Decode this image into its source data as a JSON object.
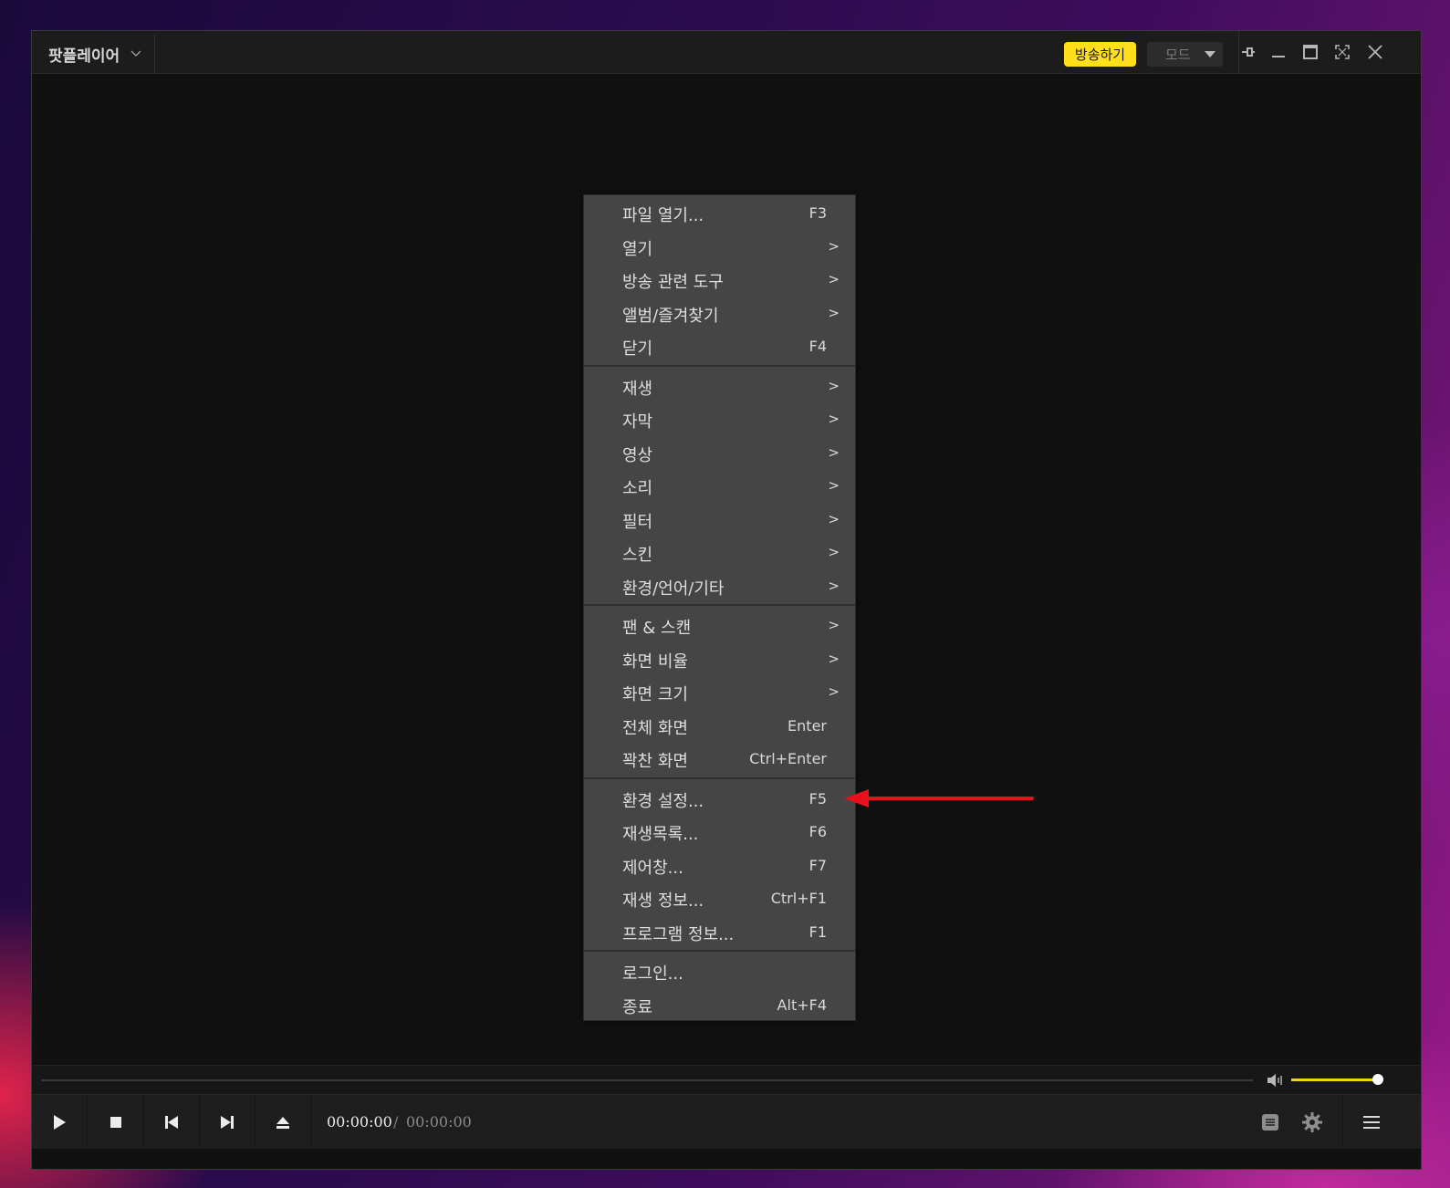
{
  "titlebar": {
    "app_name": "팟플레이어",
    "broadcast_label": "방송하기",
    "mode_label": "모드"
  },
  "menu": {
    "groups": [
      [
        {
          "label": "파일 열기...",
          "shortcut": "F3",
          "submenu": false
        },
        {
          "label": "열기",
          "shortcut": "",
          "submenu": true
        },
        {
          "label": "방송 관련 도구",
          "shortcut": "",
          "submenu": true
        },
        {
          "label": "앨범/즐겨찾기",
          "shortcut": "",
          "submenu": true
        },
        {
          "label": "닫기",
          "shortcut": "F4",
          "submenu": false
        }
      ],
      [
        {
          "label": "재생",
          "shortcut": "",
          "submenu": true
        },
        {
          "label": "자막",
          "shortcut": "",
          "submenu": true
        },
        {
          "label": "영상",
          "shortcut": "",
          "submenu": true
        },
        {
          "label": "소리",
          "shortcut": "",
          "submenu": true
        },
        {
          "label": "필터",
          "shortcut": "",
          "submenu": true
        },
        {
          "label": "스킨",
          "shortcut": "",
          "submenu": true
        },
        {
          "label": "환경/언어/기타",
          "shortcut": "",
          "submenu": true
        }
      ],
      [
        {
          "label": "팬 & 스캔",
          "shortcut": "",
          "submenu": true
        },
        {
          "label": "화면 비율",
          "shortcut": "",
          "submenu": true
        },
        {
          "label": "화면 크기",
          "shortcut": "",
          "submenu": true
        },
        {
          "label": "전체 화면",
          "shortcut": "Enter",
          "submenu": false
        },
        {
          "label": "꽉찬 화면",
          "shortcut": "Ctrl+Enter",
          "submenu": false
        }
      ],
      [
        {
          "label": "환경 설정...",
          "shortcut": "F5",
          "submenu": false
        },
        {
          "label": "재생목록...",
          "shortcut": "F6",
          "submenu": false
        },
        {
          "label": "제어창...",
          "shortcut": "F7",
          "submenu": false
        },
        {
          "label": "재생 정보...",
          "shortcut": "Ctrl+F1",
          "submenu": false
        },
        {
          "label": "프로그램 정보...",
          "shortcut": "F1",
          "submenu": false
        }
      ],
      [
        {
          "label": "로그인...",
          "shortcut": "",
          "submenu": false
        },
        {
          "label": "종료",
          "shortcut": "Alt+F4",
          "submenu": false
        }
      ]
    ],
    "submenu_arrow": ">"
  },
  "player": {
    "current_time": "00:00:00",
    "time_separator": "/",
    "total_time": "00:00:00",
    "volume_level": 1.0
  },
  "colors": {
    "accent": "#ffe01a",
    "annotation_arrow": "#e8101a"
  },
  "icons": [
    "pin-icon",
    "minimize-icon",
    "maximize-icon",
    "fullscreen-icon",
    "close-icon",
    "play-icon",
    "stop-icon",
    "previous-icon",
    "next-icon",
    "eject-icon",
    "volume-icon",
    "playlist-icon",
    "gear-icon",
    "hamburger-menu-icon"
  ]
}
